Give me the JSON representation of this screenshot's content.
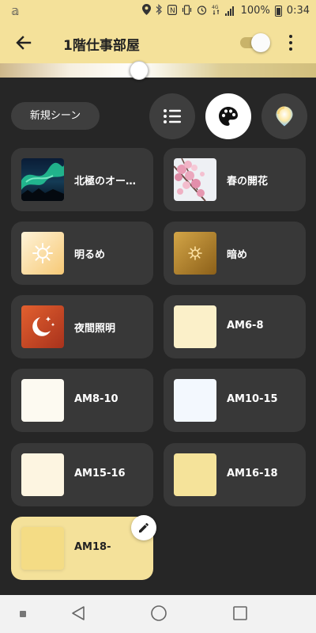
{
  "status_bar": {
    "battery": "100%",
    "time": "0:34",
    "icons": [
      "s-logo-icon",
      "location-icon",
      "bluetooth-icon",
      "nfc-icon",
      "vibrate-icon",
      "alarm-icon",
      "4g-icon",
      "signal-icon",
      "battery-icon"
    ]
  },
  "app_bar": {
    "title": "1階仕事部屋",
    "toggle_on": true
  },
  "brightness_slider": {
    "value_percent": 44
  },
  "new_scene_label": "新規シーン",
  "view_modes": [
    "list",
    "palette",
    "color-picker"
  ],
  "active_view": "palette",
  "scenes": [
    {
      "label": "北極のオー…",
      "thumb": "aurora"
    },
    {
      "label": "春の開花",
      "thumb": "blossom"
    },
    {
      "label": "明るめ",
      "thumb": "bright",
      "colors": [
        "#fde9c2",
        "#f6c976"
      ]
    },
    {
      "label": "暗め",
      "thumb": "dim",
      "colors": [
        "#c99834",
        "#8c6019"
      ]
    },
    {
      "label": "夜間照明",
      "thumb": "night",
      "colors": [
        "#d9562b",
        "#a8321c"
      ]
    },
    {
      "label": "AM6-8",
      "thumb": "solid",
      "colors": [
        "#fbf0c9"
      ]
    },
    {
      "label": "AM8-10",
      "thumb": "solid",
      "colors": [
        "#fdfaf1"
      ]
    },
    {
      "label": "AM10-15",
      "thumb": "solid",
      "colors": [
        "#f3f8fe"
      ]
    },
    {
      "label": "AM15-16",
      "thumb": "solid",
      "colors": [
        "#fdf5e1"
      ]
    },
    {
      "label": "AM16-18",
      "thumb": "solid",
      "colors": [
        "#f5e39a"
      ]
    },
    {
      "label": "AM18-",
      "thumb": "solid",
      "colors": [
        "#f4dc85"
      ],
      "selected": true
    }
  ],
  "colors": {
    "accent": "#f4e19a",
    "background": "#262626",
    "card": "#383838"
  }
}
